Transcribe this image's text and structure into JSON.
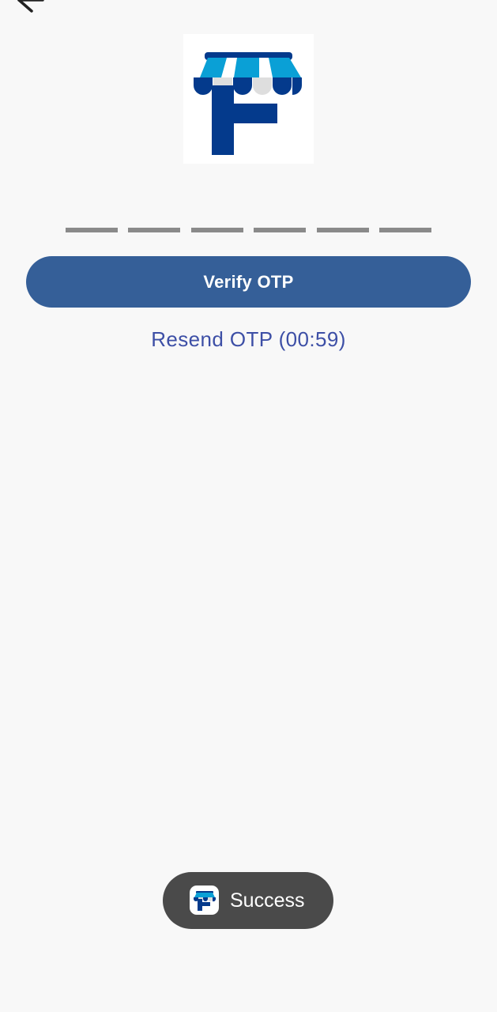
{
  "app": {
    "brand_colors": {
      "primary_button": "#355f98",
      "link": "#3d4fa6",
      "logo_dark_blue": "#043a8c",
      "logo_light_blue": "#0aa0d6"
    }
  },
  "header": {
    "back_icon": "arrow-left-icon"
  },
  "logo": {
    "icon": "storefront-f-logo"
  },
  "otp": {
    "length": 6,
    "slots": [
      "",
      "",
      "",
      "",
      "",
      ""
    ]
  },
  "verify": {
    "label": "Verify OTP"
  },
  "resend": {
    "label": "Resend OTP (00:59)"
  },
  "toast": {
    "text": "Success",
    "icon": "app-logo-icon"
  }
}
